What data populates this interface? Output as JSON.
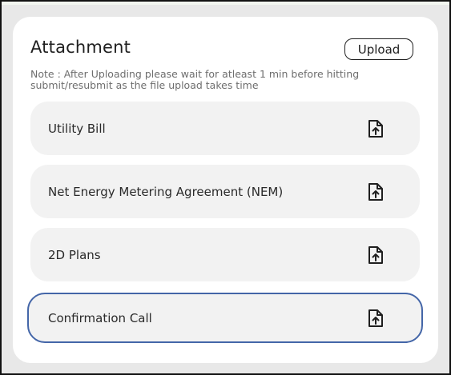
{
  "attachment": {
    "title": "Attachment",
    "upload_label": "Upload",
    "note": "Note : After Uploading please wait for atleast 1 min before hitting submit/resubmit as the file upload takes time",
    "items": [
      {
        "label": "Utility Bill",
        "icon": "file-upload-icon"
      },
      {
        "label": "Net Energy Metering Agreement (NEM)",
        "icon": "file-upload-icon"
      },
      {
        "label": "2D Plans",
        "icon": "file-upload-icon"
      },
      {
        "label": "Confirmation Call",
        "icon": "file-upload-icon",
        "selected": true
      }
    ]
  },
  "colors": {
    "selected_border": "#4466a8",
    "item_background": "#f2f2f2",
    "page_background": "#e8e8e8"
  }
}
